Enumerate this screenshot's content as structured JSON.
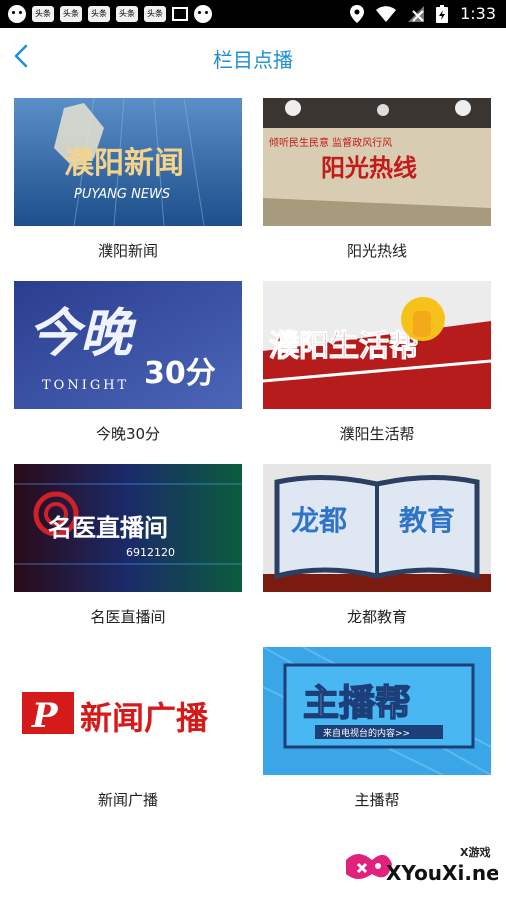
{
  "statusbar": {
    "time": "1:33",
    "notif_labels": [
      "头条",
      "头条",
      "头条",
      "头条",
      "头条"
    ]
  },
  "header": {
    "title": "栏目点播"
  },
  "programs": [
    {
      "label": "濮阳新闻",
      "thumb_text": "濮阳新闻",
      "thumb_subtext": "PUYANG NEWS"
    },
    {
      "label": "阳光热线",
      "thumb_text": "阳光热线",
      "thumb_subtext": "倾听民生民意    监督政风行风"
    },
    {
      "label": "今晚30分",
      "thumb_text": "今晚",
      "thumb_subtext": "TONIGHT",
      "thumb_extra": "30分"
    },
    {
      "label": "濮阳生活帮",
      "thumb_text": "濮阳生活帮"
    },
    {
      "label": "名医直播间",
      "thumb_text": "名医直播间",
      "thumb_subtext": "6912120"
    },
    {
      "label": "龙都教育",
      "thumb_text": "龙都",
      "thumb_extra": "教育"
    },
    {
      "label": "新闻广播",
      "thumb_text": "新闻广播",
      "thumb_logo": "P"
    },
    {
      "label": "主播帮",
      "thumb_text": "主播帮",
      "thumb_subtext": "来自电视台的内容>>"
    }
  ],
  "watermark": {
    "brand": "XYouXi.net",
    "tag": "X游戏"
  },
  "colors": {
    "accent": "#1e8fd6",
    "text": "#222222"
  }
}
